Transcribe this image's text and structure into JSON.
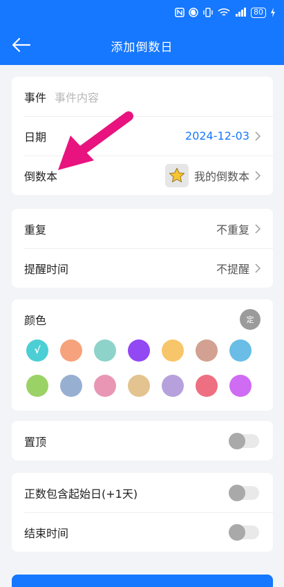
{
  "status_bar": {
    "battery": "80"
  },
  "nav": {
    "title": "添加倒数日"
  },
  "event": {
    "label": "事件",
    "placeholder": "事件内容"
  },
  "date": {
    "label": "日期",
    "value": "2024-12-03"
  },
  "book": {
    "label": "倒数本",
    "value": "我的倒数本"
  },
  "repeat": {
    "label": "重复",
    "value": "不重复"
  },
  "reminder": {
    "label": "提醒时间",
    "value": "不提醒"
  },
  "color": {
    "label": "颜色",
    "custom_label": "定",
    "selected_index": 0,
    "swatches": [
      "#4ccfd4",
      "#f6a27c",
      "#8dd3c9",
      "#9248f3",
      "#f8c66a",
      "#d2a191",
      "#69bde6",
      "#9bd266",
      "#97b0d2",
      "#e996b4",
      "#e3c38f",
      "#b6a1dc",
      "#ee6f82",
      "#cf6cf3"
    ]
  },
  "pin": {
    "label": "置顶",
    "on": false
  },
  "include_start": {
    "label": "正数包含起始日(+1天)",
    "on": false
  },
  "end_time": {
    "label": "结束时间",
    "on": false
  },
  "colors": {
    "accent": "#1677ff",
    "annotation": "#e8137f"
  }
}
